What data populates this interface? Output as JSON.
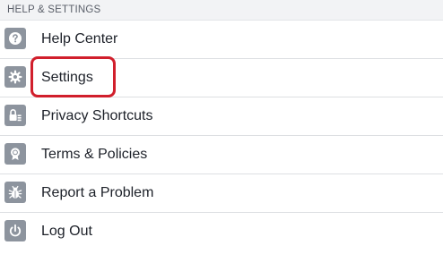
{
  "section": {
    "title": "HELP & SETTINGS"
  },
  "items": [
    {
      "label": "Help Center",
      "icon": "question-icon"
    },
    {
      "label": "Settings",
      "icon": "gear-icon"
    },
    {
      "label": "Privacy Shortcuts",
      "icon": "lock-icon"
    },
    {
      "label": "Terms & Policies",
      "icon": "badge-icon"
    },
    {
      "label": "Report a Problem",
      "icon": "bug-icon"
    },
    {
      "label": "Log Out",
      "icon": "power-icon"
    }
  ],
  "colors": {
    "icon_background": "#8d949e",
    "text": "#1d2129",
    "header_background": "#f2f3f5",
    "annotation": "#d11f2c"
  }
}
